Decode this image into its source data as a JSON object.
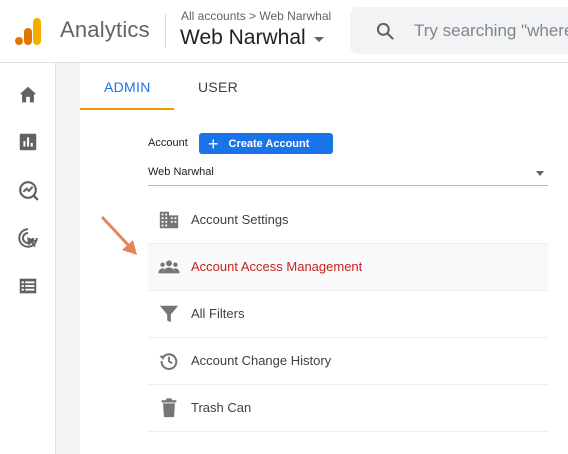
{
  "header": {
    "app_name": "Analytics",
    "breadcrumb": "All accounts > Web Narwhal",
    "property_name": "Web Narwhal",
    "search_placeholder": "Try searching \"where"
  },
  "sidebar": {
    "items": [
      {
        "icon": "home-icon"
      },
      {
        "icon": "reports-icon"
      },
      {
        "icon": "insights-icon"
      },
      {
        "icon": "advertising-icon"
      },
      {
        "icon": "list-icon"
      }
    ]
  },
  "tabs": {
    "admin": "ADMIN",
    "user": "USER",
    "active": "ADMIN"
  },
  "account": {
    "label": "Account",
    "create_button": "Create Account",
    "selected": "Web Narwhal"
  },
  "menu": {
    "items": [
      {
        "label": "Account Settings",
        "icon": "building-icon",
        "active": false
      },
      {
        "label": "Account Access Management",
        "icon": "people-icon",
        "active": true
      },
      {
        "label": "All Filters",
        "icon": "filter-icon",
        "active": false
      },
      {
        "label": "Account Change History",
        "icon": "history-icon",
        "active": false
      },
      {
        "label": "Trash Can",
        "icon": "trash-icon",
        "active": false
      }
    ]
  },
  "colors": {
    "accent_blue": "#1a73e8",
    "active_red": "#c5221f",
    "tab_underline": "#f29900",
    "arrow": "#e8825c"
  }
}
